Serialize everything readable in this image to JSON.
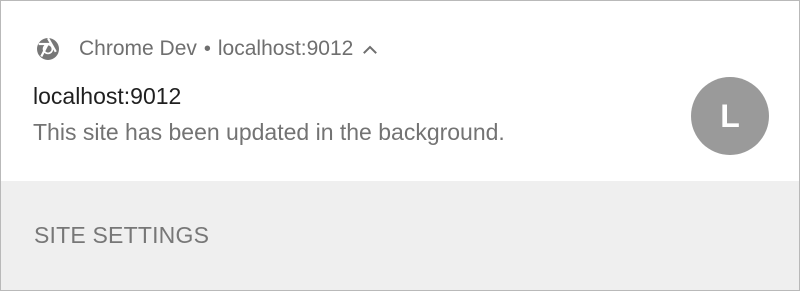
{
  "notification": {
    "app_name": "Chrome Dev",
    "separator": "•",
    "origin": "localhost:9012",
    "title": "localhost:9012",
    "message": "This site has been updated in the background.",
    "avatar_letter": "L",
    "icons": {
      "app": "chrome-icon",
      "expand": "chevron-up-icon"
    }
  },
  "actions": {
    "site_settings_label": "SITE SETTINGS"
  },
  "colors": {
    "avatar": "#9a9a9a",
    "action_bar": "#efefef",
    "muted_text": "#737373",
    "primary_text": "#1f1f1f"
  }
}
